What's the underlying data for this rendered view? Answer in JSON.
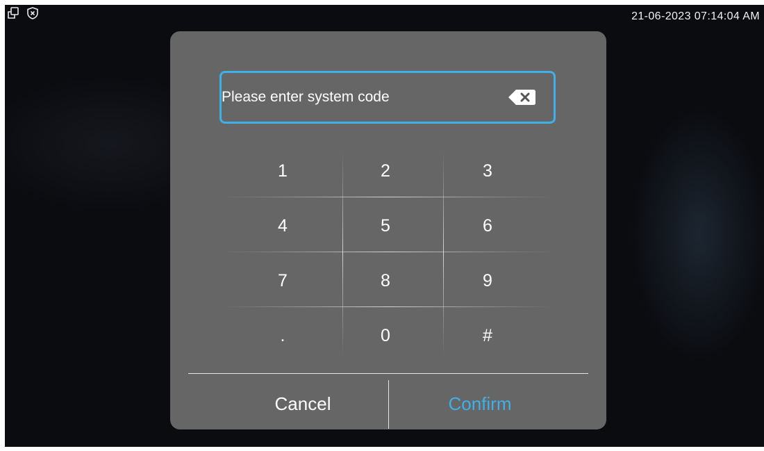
{
  "status_bar": {
    "icons": [
      "multi-window-icon",
      "shield-x-icon"
    ],
    "datetime": "21-06-2023 07:14:04 AM"
  },
  "dialog": {
    "input": {
      "value": "",
      "placeholder": "Please enter system code"
    },
    "keypad": {
      "keys": [
        "1",
        "2",
        "3",
        "4",
        "5",
        "6",
        "7",
        "8",
        "9",
        ".",
        "0",
        "#"
      ]
    },
    "cancel_label": "Cancel",
    "confirm_label": "Confirm"
  },
  "colors": {
    "accent": "#3fb0e8",
    "dialog_bg": "#666666",
    "screen_bg": "#0b0c10",
    "text": "#ffffff"
  }
}
